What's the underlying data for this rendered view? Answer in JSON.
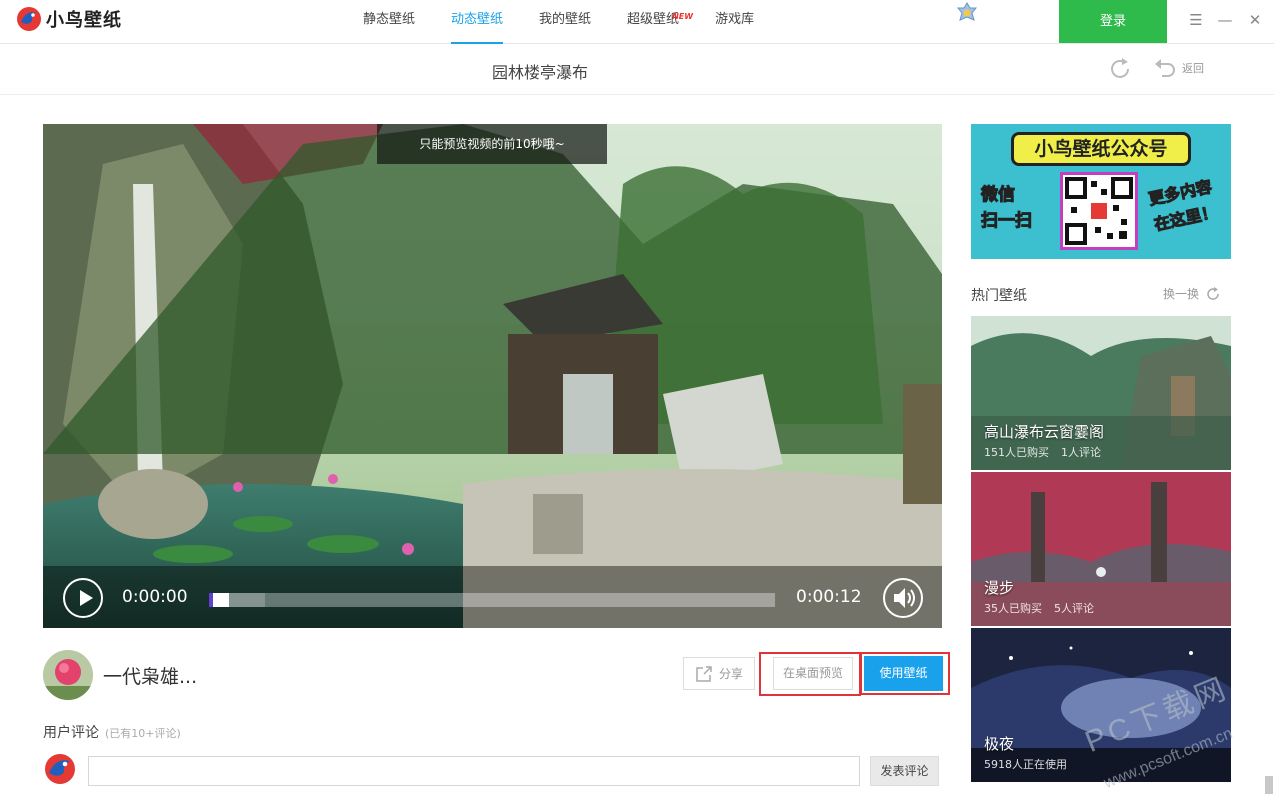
{
  "app": {
    "name": "小鸟壁纸",
    "nav": [
      {
        "label": "静态壁纸",
        "active": false
      },
      {
        "label": "动态壁纸",
        "active": true
      },
      {
        "label": "我的壁纸",
        "active": false
      },
      {
        "label": "超级壁纸",
        "active": false,
        "badge": "NEW"
      },
      {
        "label": "游戏库",
        "active": false
      }
    ],
    "login_label": "登录",
    "accent_color": "#1aa3e8",
    "login_color": "#2fba4c"
  },
  "page": {
    "title": "园林楼亭瀑布",
    "back_label": "返回"
  },
  "video": {
    "notice": "只能预览视频的前10秒哦~",
    "current_time": "0:00:00",
    "duration": "0:00:12",
    "progress_fraction": 0.0
  },
  "author": {
    "name": "一代枭雄..."
  },
  "actions": {
    "share_label": "分享",
    "preview_label": "在桌面预览",
    "use_label": "使用壁纸"
  },
  "comments": {
    "title": "用户评论",
    "count": "(已有10+评论)",
    "post_label": "发表评论"
  },
  "banner": {
    "title": "小鸟壁纸公众号",
    "left_text": [
      "微信",
      "扫一扫"
    ],
    "right_text": [
      "更多内容",
      "在这里！"
    ]
  },
  "hot": {
    "title": "热门壁纸",
    "swap_label": "换一换",
    "items": [
      {
        "title": "高山瀑布云窗霎阁",
        "buyers": "151人已购买",
        "comments": "1人评论"
      },
      {
        "title": "漫步",
        "buyers": "35人已购买",
        "comments": "5人评论"
      },
      {
        "title": "极夜",
        "buyers": "5918人正在使用",
        "comments": ""
      }
    ]
  },
  "watermark": {
    "text": "PC下载网",
    "url": "www.pcsoft.com.cn"
  }
}
